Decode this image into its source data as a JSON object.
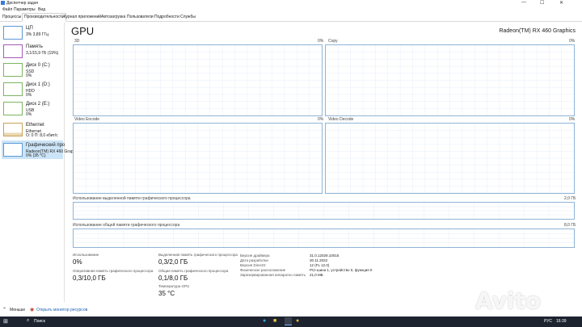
{
  "window": {
    "title": "Диспетчер задач"
  },
  "menu": [
    "Файл",
    "Параметры",
    "Вид"
  ],
  "tabs": [
    "Процессы",
    "Производительность",
    "Журнал приложений",
    "Автозагрузка",
    "Пользователи",
    "Подробности",
    "Службы"
  ],
  "active_tab_index": 1,
  "sidebar": [
    {
      "name": "ЦП",
      "line2": "3% 3,89 ГГц",
      "line3": ""
    },
    {
      "name": "Память",
      "line2": "3,1/15,9 ГБ (19%)",
      "line3": ""
    },
    {
      "name": "Диск 0 (C:)",
      "line2": "SSD",
      "line3": "0%"
    },
    {
      "name": "Диск 1 (D:)",
      "line2": "HDD",
      "line3": "0%"
    },
    {
      "name": "Диск 2 (E:)",
      "line2": "USB",
      "line3": "0%"
    },
    {
      "name": "Ethernet",
      "line2": "Ethernet",
      "line3": "О: 0 П: 8,0 кбит/с"
    },
    {
      "name": "Графический про",
      "line2": "Radeon(TM) RX 460 Grap",
      "line3": "0% (35 °C)"
    }
  ],
  "sidebar_selected_index": 6,
  "main": {
    "title": "GPU",
    "device": "Radeon(TM) RX 460 Graphics",
    "graphs": [
      {
        "label": "3D",
        "pct": "0%"
      },
      {
        "label": "Copy",
        "pct": "0%"
      },
      {
        "label": "Video Encode",
        "pct": "0%"
      },
      {
        "label": "Video Decode",
        "pct": "0%"
      }
    ],
    "dedicated_label": "Использование выделенной памяти графического процессора",
    "dedicated_max": "2,0 ГБ",
    "shared_label": "Использование общей памяти графического процессора",
    "shared_max": "8,0 ГБ",
    "stats": {
      "util_label": "Использование",
      "util_value": "0%",
      "ded_label": "Выделенная память графического процессора",
      "ded_value": "0,3/2,0 ГБ",
      "total_label": "Оперативная память графического процессора",
      "total_value": "0,3/10,0 ГБ",
      "shared_label": "Общая память графического процессора",
      "shared_value": "0,1/8,0 ГБ",
      "temp_label": "Температура GPU",
      "temp_value": "35 °C"
    },
    "info": [
      {
        "k": "Версия драйвера",
        "v": "31.0.12029.10015"
      },
      {
        "k": "Дата разработки",
        "v": "30.11.2022"
      },
      {
        "k": "Версия DirectX:",
        "v": "12 (FL 12.0)"
      },
      {
        "k": "Физическое расположение",
        "v": "PCI-шина 1, устройство 0, функция 0"
      },
      {
        "k": "Зарезервированная аппаратно память",
        "v": "21,0 МБ"
      }
    ]
  },
  "bottom": {
    "less": "Меньше",
    "open_monitor": "Открыть монитор ресурсов"
  },
  "taskbar": {
    "search": "Поиск",
    "time": "16:39",
    "lang": "РУС"
  },
  "watermark": "Avito",
  "colors": {
    "graph_border": "#8fb4d6",
    "accent": "#1a5fb4",
    "selected": "#cce4f7"
  }
}
